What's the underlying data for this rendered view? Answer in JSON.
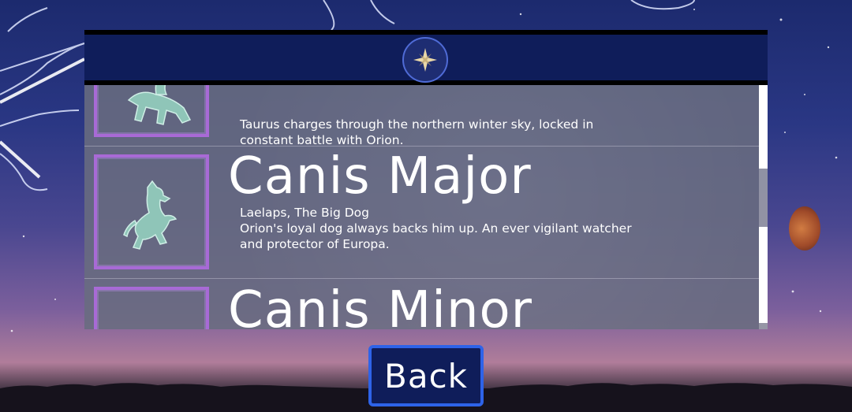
{
  "header": {
    "emblem_icon": "compass-star-icon"
  },
  "list": {
    "items": [
      {
        "name": "",
        "subtitle": "",
        "description": "Taurus charges through the northern winter sky, locked in constant battle with Orion.",
        "icon": "taurus-bull-icon"
      },
      {
        "name": "Canis Major",
        "subtitle": "Laelaps, The Big Dog",
        "description": "Orion's loyal dog always backs him up. An ever vigilant watcher and protector of Europa.",
        "icon": "big-dog-icon"
      },
      {
        "name": "Canis Minor",
        "subtitle": "",
        "description": "",
        "icon": "little-dog-icon"
      }
    ]
  },
  "back_button": {
    "label": "Back"
  },
  "colors": {
    "panel_header": "#0f1d5a",
    "thumb_border": "#a86ad6",
    "button_border": "#2e63e8"
  }
}
